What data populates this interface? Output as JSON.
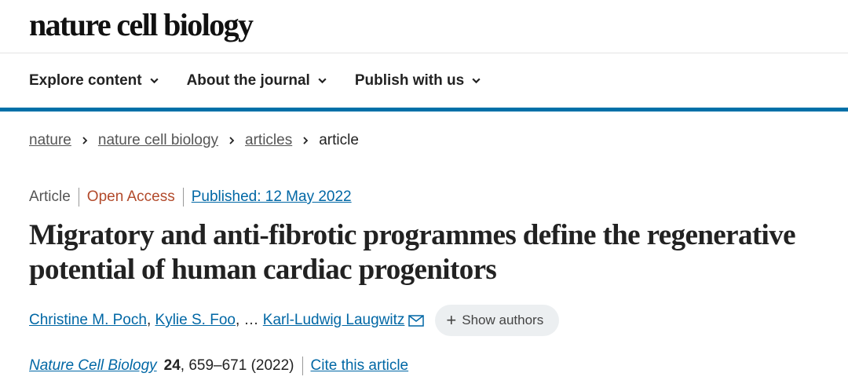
{
  "site": {
    "logo": "nature cell biology"
  },
  "nav": {
    "items": [
      {
        "label": "Explore content"
      },
      {
        "label": "About the journal"
      },
      {
        "label": "Publish with us"
      }
    ]
  },
  "breadcrumb": {
    "items": [
      "nature",
      "nature cell biology",
      "articles"
    ],
    "current": "article"
  },
  "article": {
    "type": "Article",
    "access": "Open Access",
    "published": "Published: 12 May 2022",
    "title": "Migratory and anti-fibrotic programmes define the regenerative potential of human cardiac progenitors",
    "authors": [
      "Christine M. Poch",
      "Kylie S. Foo",
      "Karl-Ludwig Laugwitz"
    ],
    "author_sep": ",",
    "ellipsis": "…",
    "show_authors": "Show authors",
    "journal": "Nature Cell Biology",
    "volume": "24",
    "pages_year": ", 659–671 (2022)",
    "cite": "Cite this article"
  },
  "colors": {
    "accent": "#0070a8",
    "link": "#0067a5",
    "open_access": "#b24a2b"
  }
}
